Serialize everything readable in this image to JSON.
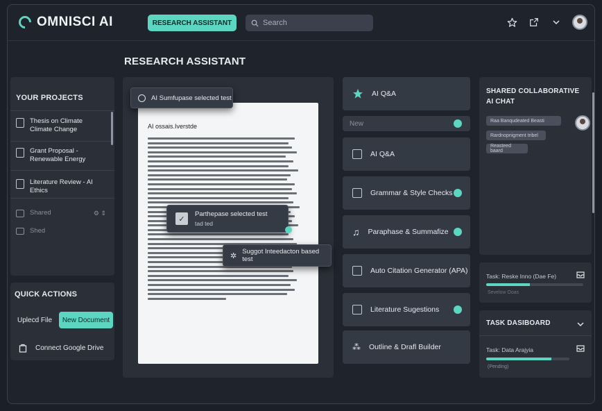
{
  "header": {
    "app_name": "OMNISCI AI",
    "active_tab": "RESEARCH ASSISTANT",
    "search_placeholder": "Search",
    "icons": [
      "star-icon",
      "share-icon",
      "chevron-down-icon",
      "avatar"
    ]
  },
  "page_title": "RESEARCH ASSISTANT",
  "projects": {
    "heading": "YOUR PROJECTS",
    "items": [
      {
        "label": "Thesis on Climate Climate Change"
      },
      {
        "label": "Grant Proposal - Renewable Energy"
      },
      {
        "label": "Literature Review - AI Ethics"
      }
    ],
    "shared": [
      {
        "label": "Shared"
      },
      {
        "label": "Shed"
      }
    ]
  },
  "quick_actions": {
    "heading": "QUICK ACTIONS",
    "upload_label": "Uplecd File",
    "new_doc_label": "New Document",
    "drive_label": "Connect Google Drive"
  },
  "editor": {
    "top_tooltip": "AI Sumfupase selected test",
    "doc_heading": "AI ossais.Iverstde",
    "mid_tooltip_line1": "Parthepase selected test",
    "mid_tooltip_line2": "tad ted",
    "suggest_tooltip": "Suggot Inteedacton based test"
  },
  "tools": {
    "items": [
      {
        "label": "AI Q&A",
        "dot": false
      },
      {
        "label": "AI Q&A",
        "dot": false
      },
      {
        "label": "Grammar & Style Checks",
        "dot": true
      },
      {
        "label": "Paraphase & Summafize",
        "dot": true
      },
      {
        "label": "Auto Citation Generator (APA)",
        "dot": false
      },
      {
        "label": "Literature Sugestions",
        "dot": true
      },
      {
        "label": "Outline & Drafl Builder",
        "dot": false
      }
    ],
    "new_label": "New"
  },
  "chat": {
    "heading_line1": "SHARED COLLABORATIVE",
    "heading_line2": "AI CHAT",
    "messages": [
      "Raa Banqudeated Beasti",
      "Rardnopnigment tribel",
      "Reasteed baard"
    ]
  },
  "tasks": {
    "card1_title": "Task: Reske Inno (Dae Fe)",
    "card1_sub": "Sevelow Ooas",
    "card1_progress": 0.45,
    "dashboard_heading": "TASK DASIBOARD",
    "card2_title": "Task: Data Arajyia",
    "card2_sub": "(Pending)",
    "card2_progress": 0.78
  },
  "colors": {
    "accent": "#5cd6c0",
    "background": "#1b1f27",
    "panel": "#2a2f38"
  }
}
